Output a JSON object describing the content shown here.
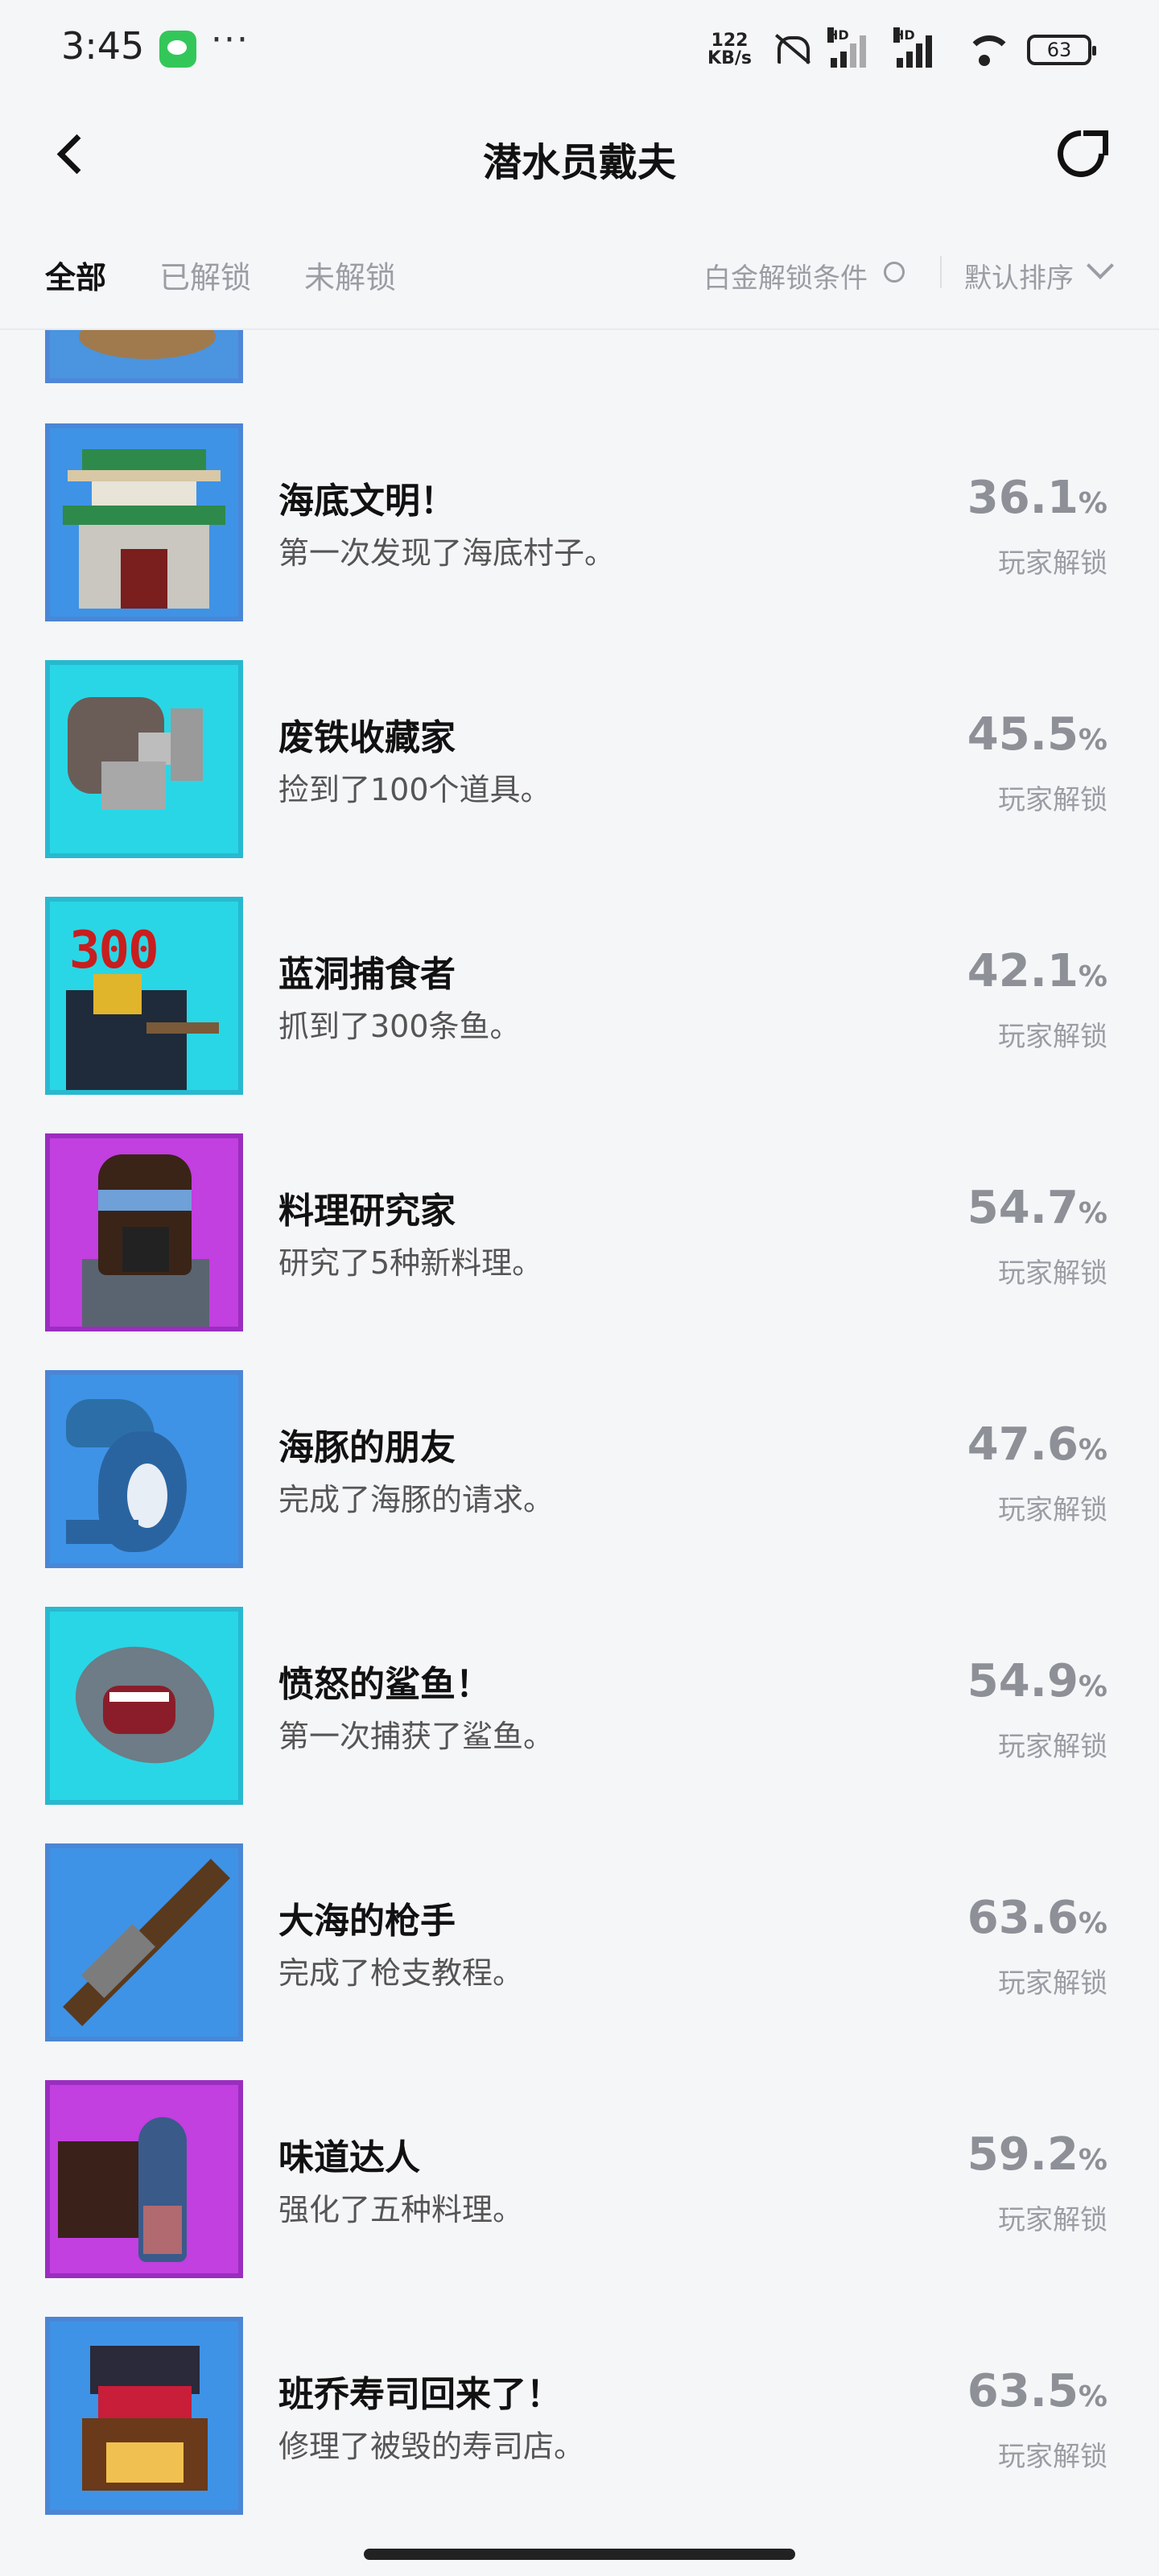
{
  "status_bar": {
    "time": "3:45",
    "dots": "···",
    "speed_line1": "122",
    "speed_line2": "KB/s",
    "hd": "HD",
    "battery": "63"
  },
  "nav": {
    "title": "潜水员戴夫"
  },
  "filters": {
    "tabs": [
      "全部",
      "已解锁",
      "未解锁"
    ],
    "platinum_label": "白金解锁条件",
    "sort_label": "默认排序"
  },
  "achievements": [
    {
      "title": "海底文明！",
      "desc": "第一次发现了海底村子。",
      "percent": "36.1",
      "unit": "%",
      "label": "玩家解锁",
      "bg": "blue",
      "icon": "temple-icon"
    },
    {
      "title": "废铁收藏家",
      "desc": "捡到了100个道具。",
      "percent": "45.5",
      "unit": "%",
      "label": "玩家解锁",
      "bg": "cyan",
      "icon": "scrap-hammer-icon"
    },
    {
      "title": "蓝洞捕食者",
      "desc": "抓到了300条鱼。",
      "percent": "42.1",
      "unit": "%",
      "label": "玩家解锁",
      "bg": "cyan",
      "icon": "diver-300-icon"
    },
    {
      "title": "料理研究家",
      "desc": "研究了5种新料理。",
      "percent": "54.7",
      "unit": "%",
      "label": "玩家解锁",
      "bg": "purple",
      "icon": "chef-icon"
    },
    {
      "title": "海豚的朋友",
      "desc": "完成了海豚的请求。",
      "percent": "47.6",
      "unit": "%",
      "label": "玩家解锁",
      "bg": "blue",
      "icon": "dolphin-icon"
    },
    {
      "title": "愤怒的鲨鱼！",
      "desc": "第一次捕获了鲨鱼。",
      "percent": "54.9",
      "unit": "%",
      "label": "玩家解锁",
      "bg": "cyan",
      "icon": "shark-icon"
    },
    {
      "title": "大海的枪手",
      "desc": "完成了枪支教程。",
      "percent": "63.6",
      "unit": "%",
      "label": "玩家解锁",
      "bg": "blue",
      "icon": "harpoon-gun-icon"
    },
    {
      "title": "味道达人",
      "desc": "强化了五种料理。",
      "percent": "59.2",
      "unit": "%",
      "label": "玩家解锁",
      "bg": "purple",
      "icon": "fish-dish-icon"
    },
    {
      "title": "班乔寿司回来了！",
      "desc": "修理了被毁的寿司店。",
      "percent": "63.5",
      "unit": "%",
      "label": "玩家解锁",
      "bg": "blue",
      "icon": "sushi-shop-icon"
    }
  ],
  "colors": {
    "blue_tile": "#3e93e6",
    "cyan_tile": "#29d6e6",
    "purple_tile": "#c23fe0",
    "percent_gray": "#8d9096"
  }
}
